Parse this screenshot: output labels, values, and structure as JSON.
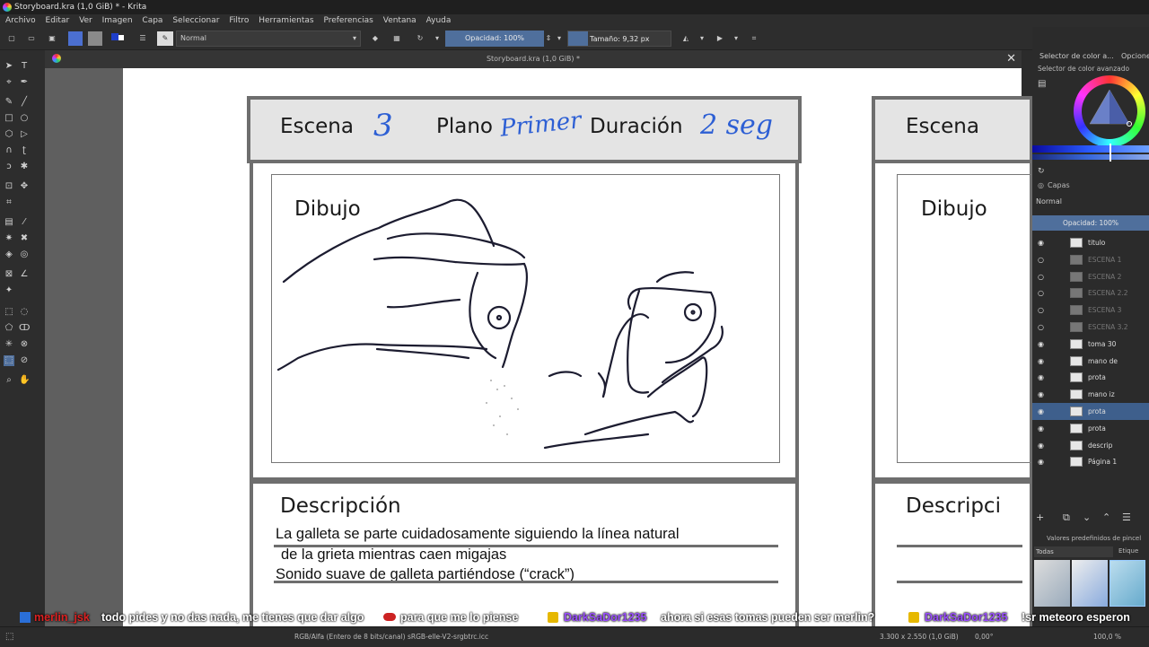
{
  "window": {
    "title": "Storyboard.kra (1,0 GiB) * - Krita"
  },
  "menu": [
    "Archivo",
    "Editar",
    "Ver",
    "Imagen",
    "Capa",
    "Seleccionar",
    "Filtro",
    "Herramientas",
    "Preferencias",
    "Ventana",
    "Ayuda"
  ],
  "toolbar": {
    "blend_mode": "Normal",
    "opacity": "Opacidad: 100%",
    "size": "Tamaño: 9,32 px"
  },
  "document": {
    "tab_title": "Storyboard.kra (1,0 GiB) *",
    "panel1": {
      "escena_label": "Escena",
      "escena_value": "3",
      "plano_label": "Plano",
      "plano_value": "Primer",
      "duracion_label": "Duración",
      "duracion_value": "2 seg",
      "dibujo_label": "Dibujo",
      "descripcion_label": "Descripción",
      "desc_line1": "La galleta se parte cuidadosamente siguiendo la línea natural",
      "desc_line2": "de la grieta mientras caen migajas",
      "desc_line3": "Sonido suave de galleta partiéndose (“crack”)"
    },
    "panel2": {
      "escena_label": "Escena",
      "dibujo_label": "Dibujo",
      "descripcion_label": "Descripci"
    }
  },
  "dock": {
    "tab_color": "Selector de color a...",
    "tab_options": "Opcione",
    "advanced_color": "Selector de color avanzado",
    "layers_title": "Capas",
    "layers_blend": "Normal",
    "layers_opacity": "Opacidad:  100%",
    "layers": [
      {
        "name": "titulo",
        "visible": true,
        "dim": false,
        "selected": false
      },
      {
        "name": "ESCENA 1",
        "visible": false,
        "dim": true,
        "selected": false
      },
      {
        "name": "ESCENA 2",
        "visible": false,
        "dim": true,
        "selected": false
      },
      {
        "name": "ESCENA 2.2",
        "visible": false,
        "dim": true,
        "selected": false
      },
      {
        "name": "ESCENA 3",
        "visible": false,
        "dim": true,
        "selected": false
      },
      {
        "name": "ESCENA 3.2",
        "visible": false,
        "dim": true,
        "selected": false
      },
      {
        "name": "toma 30",
        "visible": true,
        "dim": false,
        "selected": false
      },
      {
        "name": "mano de",
        "visible": true,
        "dim": false,
        "selected": false
      },
      {
        "name": "prota",
        "visible": true,
        "dim": false,
        "selected": false
      },
      {
        "name": "mano iz",
        "visible": true,
        "dim": false,
        "selected": false
      },
      {
        "name": "prota",
        "visible": true,
        "dim": false,
        "selected": true
      },
      {
        "name": "prota",
        "visible": true,
        "dim": false,
        "selected": false
      },
      {
        "name": "descrip",
        "visible": true,
        "dim": false,
        "selected": false
      },
      {
        "name": "Página 1",
        "visible": true,
        "dim": false,
        "selected": false
      }
    ],
    "brush_presets_title": "Valores predefinidos de pincel",
    "brush_filter": "Todas",
    "brush_tag": "Etique"
  },
  "chat": {
    "user1": "merlin_jsk",
    "msg1": "todo pides y no das nada, me tienes que dar algo",
    "msg1b": "para que me lo piense",
    "user2": "DarkSaDor1235",
    "msg2": "ahora si esas tomas pueden ser merlin?",
    "user3": "DarkSaDor1235",
    "msg3": "!sr meteoro esperon"
  },
  "status": {
    "colorspace": "RGB/Alfa (Entero de 8 bits/canal)  sRGB-elle-V2-srgbtrc.icc",
    "dimensions": "3.300 x 2.550 (1,0 GiB)",
    "rotation": "0,00°",
    "zoom": "100,0 %"
  },
  "colors": {
    "ui_bg": "#2d2d2d",
    "accent": "#4f6f9c",
    "handwriting": "#2d5fd4",
    "selected_layer": "#3e5f8c"
  }
}
